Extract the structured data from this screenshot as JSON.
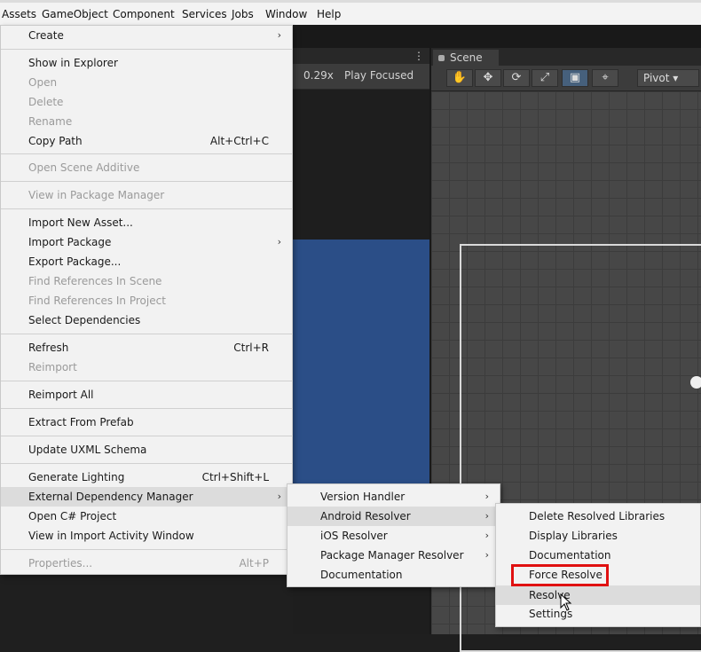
{
  "menubar": [
    "Assets",
    "GameObject",
    "Component",
    "Services",
    "Jobs",
    "Window",
    "Help"
  ],
  "game": {
    "zoom": "0.29x",
    "play_focused": "Play Focused",
    "kebab": "⋮"
  },
  "scene": {
    "tab": "Scene",
    "tools": [
      "hand-icon",
      "move-icon",
      "rotate-icon",
      "scale-icon",
      "rect-tool-icon",
      "transform-icon"
    ],
    "tool_glyphs": [
      "✋",
      "✥",
      "⟳",
      "⤢",
      "▣",
      "⌖"
    ],
    "pivot": "Pivot ▾"
  },
  "assets_menu": [
    {
      "label": "Create",
      "submenu": true
    },
    {
      "label": "Show in Explorer"
    },
    {
      "label": "Open",
      "disabled": true
    },
    {
      "label": "Delete",
      "disabled": true
    },
    {
      "label": "Rename",
      "disabled": true
    },
    {
      "label": "Copy Path",
      "shortcut": "Alt+Ctrl+C"
    },
    {
      "label": "Open Scene Additive",
      "disabled": true
    },
    {
      "label": "View in Package Manager",
      "disabled": true
    },
    {
      "label": "Import New Asset..."
    },
    {
      "label": "Import Package",
      "submenu": true
    },
    {
      "label": "Export Package..."
    },
    {
      "label": "Find References In Scene",
      "disabled": true
    },
    {
      "label": "Find References In Project",
      "disabled": true
    },
    {
      "label": "Select Dependencies"
    },
    {
      "label": "Refresh",
      "shortcut": "Ctrl+R"
    },
    {
      "label": "Reimport",
      "disabled": true
    },
    {
      "label": "Reimport All"
    },
    {
      "label": "Extract From Prefab"
    },
    {
      "label": "Update UXML Schema"
    },
    {
      "label": "Generate Lighting",
      "shortcut": "Ctrl+Shift+L"
    },
    {
      "label": "External Dependency Manager",
      "submenu": true,
      "highlighted": true
    },
    {
      "label": "Open C# Project"
    },
    {
      "label": "View in Import Activity Window"
    },
    {
      "label": "Properties...",
      "shortcut": "Alt+P",
      "disabled": true
    }
  ],
  "edm_menu": [
    {
      "label": "Version Handler",
      "submenu": true
    },
    {
      "label": "Android Resolver",
      "submenu": true,
      "highlighted": true
    },
    {
      "label": "iOS Resolver",
      "submenu": true
    },
    {
      "label": "Package Manager Resolver",
      "submenu": true
    },
    {
      "label": "Documentation"
    }
  ],
  "android_menu": [
    {
      "label": "Delete Resolved Libraries"
    },
    {
      "label": "Display Libraries"
    },
    {
      "label": "Documentation"
    },
    {
      "label": "Force Resolve",
      "annotated": true
    },
    {
      "label": "Resolve",
      "highlighted": true
    },
    {
      "label": "Settings"
    }
  ],
  "arrow_glyph": "›"
}
